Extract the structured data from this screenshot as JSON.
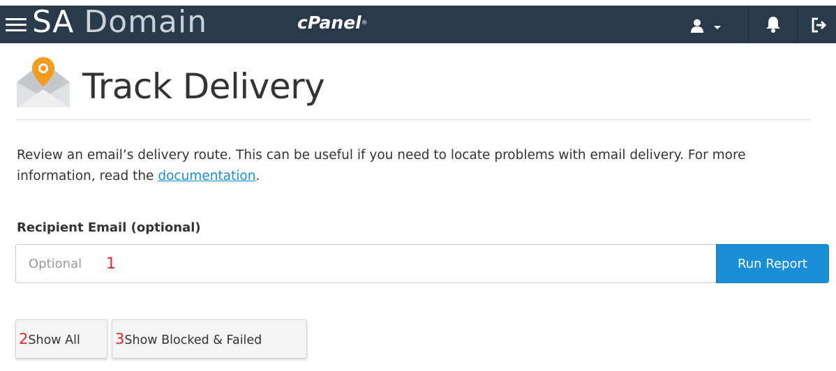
{
  "topbar": {
    "brand_part1": "SA",
    "brand_part2": "Domain",
    "cpanel_logo": "cPanel",
    "icons": [
      "menu-icon",
      "user-icon",
      "chevron-down-icon",
      "bell-icon",
      "logout-icon"
    ]
  },
  "page": {
    "title": "Track Delivery",
    "icon": "email-location-pin-icon",
    "description_text": "Review an email’s delivery route. This can be useful if you need to locate problems with email delivery. For more information, read the ",
    "documentation_link": "documentation",
    "description_end": "."
  },
  "form": {
    "recipient_label": "Recipient Email (optional)",
    "recipient_placeholder": "Optional",
    "recipient_value": "",
    "run_report_label": "Run Report",
    "show_all_label": "Show All",
    "show_blocked_label": "Show Blocked & Failed"
  },
  "annotations": {
    "input_marker": "1",
    "show_all_marker": "2",
    "show_blocked_marker": "3"
  },
  "colors": {
    "topbar_bg": "#293a4a",
    "primary_button": "#1a8ed6",
    "link": "#1a8ed6",
    "annotation": "#e8232b"
  }
}
